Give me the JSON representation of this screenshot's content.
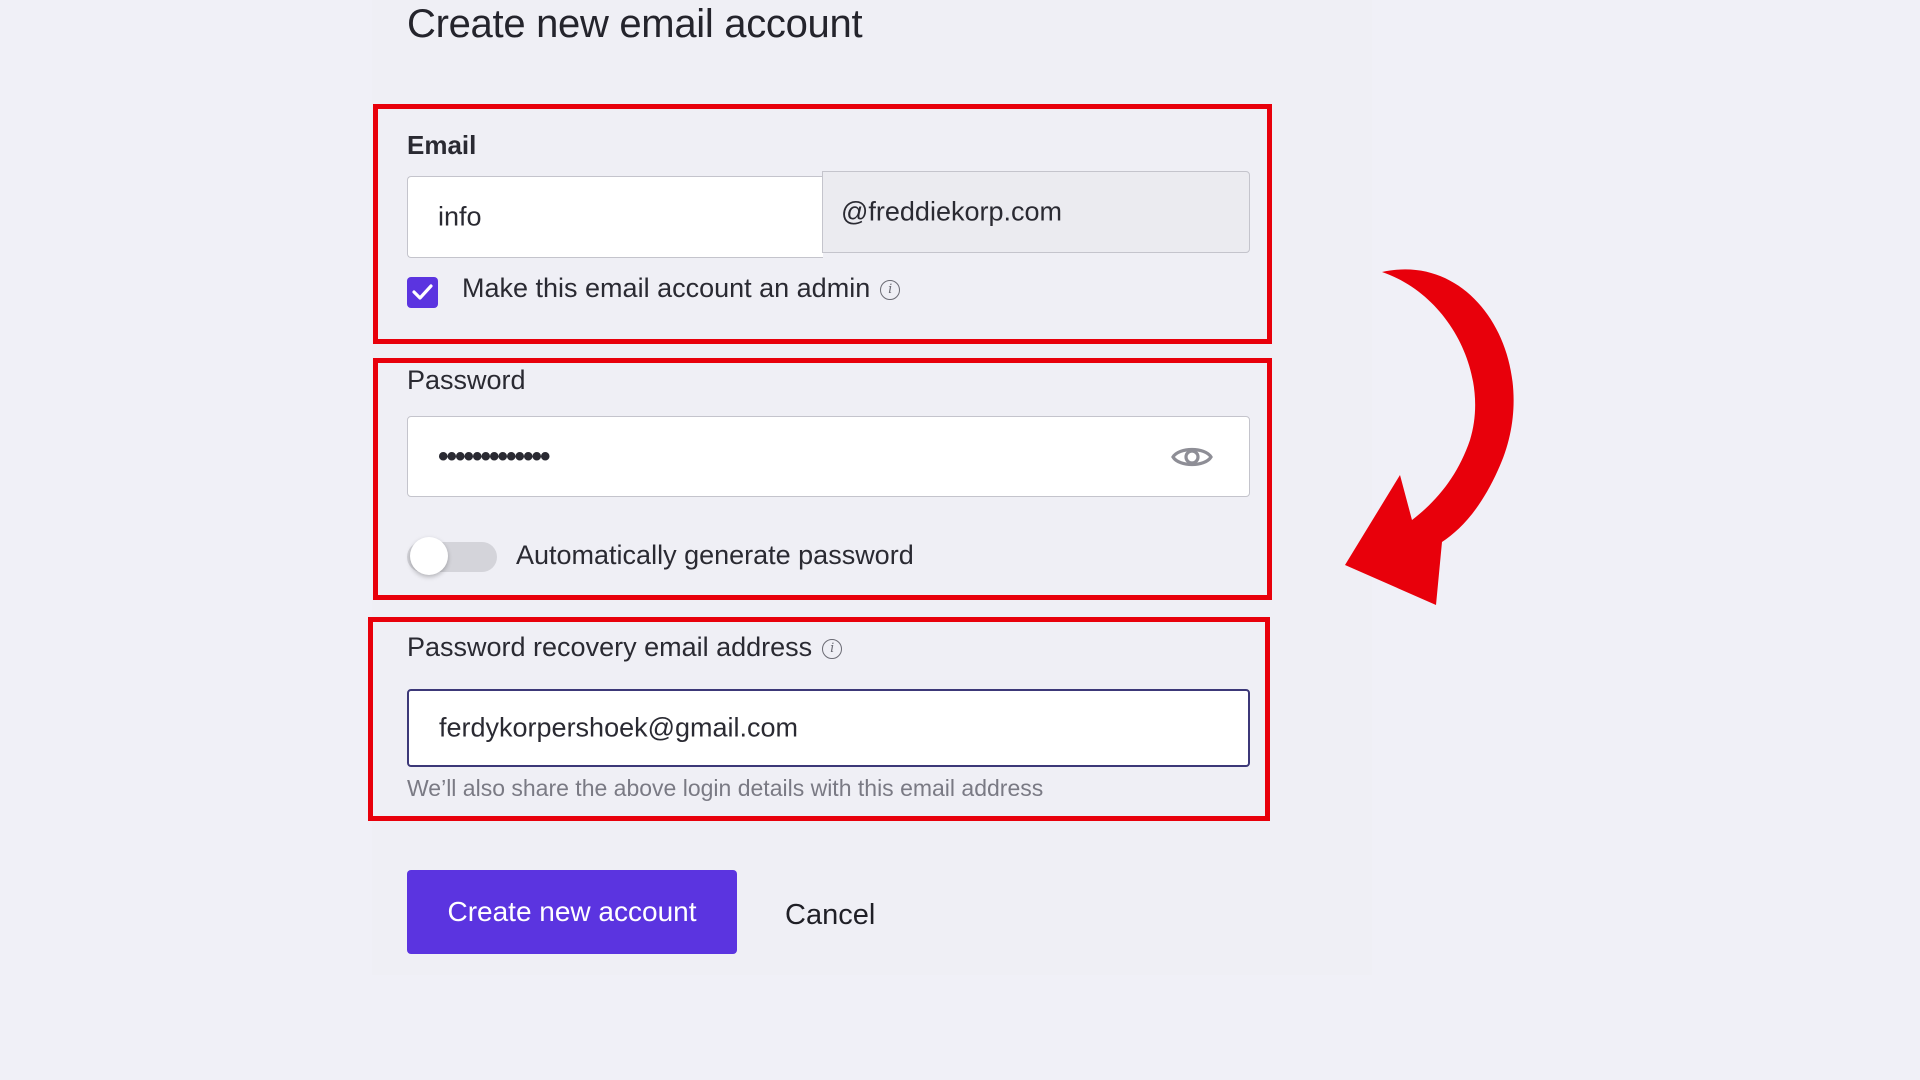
{
  "page": {
    "title": "Create new email account"
  },
  "email_section": {
    "label": "Email",
    "local_part": "info",
    "domain": "@freddiekorp.com",
    "admin_checkbox_label": "Make this email account an admin",
    "admin_checked": true
  },
  "password_section": {
    "label": "Password",
    "masked_value": "•••••••••••••",
    "auto_generate_label": "Automatically generate password",
    "auto_generate_enabled": false
  },
  "recovery_section": {
    "label": "Password recovery email address",
    "value": "ferdykorpershoek@gmail.com",
    "helper": "We’ll also share the above login details with this email address"
  },
  "actions": {
    "create_label": "Create new account",
    "cancel_label": "Cancel"
  },
  "icons": {
    "checkbox_check": "check-icon",
    "info": "info-icon",
    "password_visibility": "eye-icon",
    "annotation": "curved-arrow-icon"
  },
  "colors": {
    "accent": "#5b34e0",
    "highlight": "#e8000b",
    "background": "#f0f0f7"
  }
}
